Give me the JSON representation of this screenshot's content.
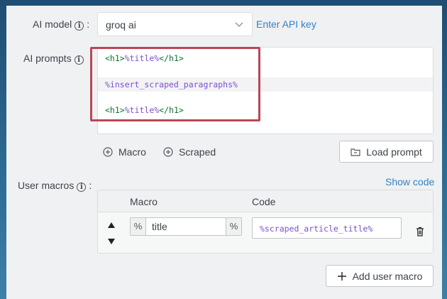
{
  "model": {
    "label": "AI model",
    "info_icon": "info-icon",
    "colon": ":",
    "selected": "groq ai",
    "dropdown_icon": "chevron-down-icon",
    "api_link": "Enter API key"
  },
  "prompts": {
    "label": "AI prompts",
    "colon": "",
    "lines": [
      {
        "open": "<h1>",
        "macro": "%title%",
        "close": "</h1>"
      },
      {
        "open": "",
        "macro": "%insert_scraped_paragraphs%",
        "close": ""
      },
      {
        "open": "<h1>",
        "macro": "%title%",
        "close": "</h1>"
      }
    ],
    "macro_btn": "Macro",
    "scraped_btn": "Scraped",
    "load_btn": "Load prompt"
  },
  "macros": {
    "label": "User macros",
    "colon": ":",
    "show_code": "Show code",
    "col_macro": "Macro",
    "col_code": "Code",
    "rows": [
      {
        "prefix": "%",
        "name": "title",
        "suffix": "%",
        "code": "%scraped_article_title%"
      }
    ],
    "add_btn": "Add user macro"
  },
  "colors": {
    "accent": "#3582c4",
    "highlight_border": "#b84857",
    "macro": "#7c4fd0",
    "tag": "#0f6f2f"
  }
}
